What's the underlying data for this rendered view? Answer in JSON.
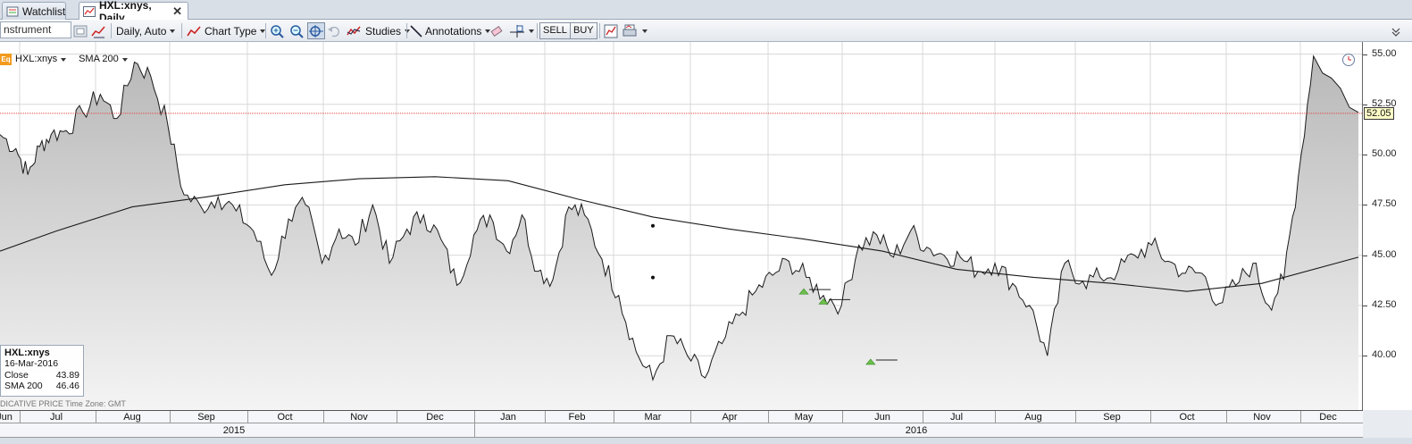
{
  "tabs": [
    {
      "label": "Watchlist",
      "icon": "watchlist-icon",
      "active": false
    },
    {
      "label": "HXL:xnys, Daily",
      "icon": "chart-tab-icon",
      "active": true,
      "close": "✕"
    }
  ],
  "toolbar": {
    "instrument_value": "nstrument",
    "interval_label": "Daily,  Auto",
    "chart_type_label": "Chart Type",
    "studies_label": "Studies",
    "annotations_label": "Annotations",
    "sell_label": "SELL",
    "buy_label": "BUY"
  },
  "legend": {
    "badge": "Eq",
    "symbol": "HXL:xnys",
    "study": "SMA 200"
  },
  "info_box": {
    "title": "HXL:xnys",
    "date": "16-Mar-2016",
    "close_label": "Close",
    "close_value": "43.89",
    "sma_label": "SMA 200",
    "sma_value": "46.46"
  },
  "footer_note": "DICATIVE PRICE    Time Zone: GMT",
  "price_tag": "52.05",
  "colors": {
    "area_fill": "#cfcfcf",
    "price_line": "#1a1a1a",
    "sma_line": "#1a1a1a",
    "last_price_line": "#d44",
    "marker": "#6cc04a"
  },
  "chart_data": {
    "type": "area",
    "ylim": [
      37.3,
      55.6
    ],
    "y_ticks": [
      "55.00",
      "52.50",
      "50.00",
      "47.50",
      "45.00",
      "42.50",
      "40.00"
    ],
    "y_tick_values": [
      55,
      52.5,
      50,
      47.5,
      45,
      42.5,
      40
    ],
    "x_month_labels": [
      "Jun",
      "Jul",
      "Aug",
      "Sep",
      "Oct",
      "Nov",
      "Dec",
      "Jan",
      "Feb",
      "Mar",
      "Apr",
      "May",
      "Jun",
      "Jul",
      "Aug",
      "Sep",
      "Oct",
      "Nov",
      "Dec"
    ],
    "years": [
      "2015",
      "2016"
    ],
    "last_price": 52.05,
    "series": [
      {
        "name": "HXL:xnys",
        "x": [
          0,
          0.22,
          0.45,
          0.68,
          0.9,
          1.13,
          1.35,
          1.58,
          1.8,
          2.03,
          2.25,
          2.48,
          2.7,
          2.93,
          3.15,
          3.38,
          3.6,
          3.83,
          4.05,
          4.28,
          4.5,
          4.73,
          4.95,
          5.18,
          5.4,
          5.63,
          5.85,
          6.08,
          6.3,
          6.53,
          6.75,
          6.98,
          7.2,
          7.43,
          7.65,
          7.88,
          8.1,
          8.33,
          8.55,
          8.78,
          9.0,
          9.23,
          9.45,
          9.68,
          9.9,
          10.13,
          10.35,
          10.58,
          10.8,
          11.03,
          11.25,
          11.48,
          11.7,
          11.93,
          12.15,
          12.38,
          12.6,
          12.83,
          13.05,
          13.28,
          13.5,
          13.73,
          13.95,
          14.18,
          14.4,
          14.63,
          14.85,
          15.08,
          15.3,
          15.53,
          15.75,
          15.98,
          16.2,
          16.43,
          16.65,
          16.88,
          17.1,
          17.33,
          17.55,
          17.78,
          18.0
        ],
        "values": [
          51.0,
          50.3,
          49.0,
          50.4,
          51.0,
          51.2,
          52.1,
          53.0,
          51.8,
          54.6,
          53.9,
          51.5,
          48.0,
          47.4,
          47.9,
          47.2,
          46.2,
          44.0,
          46.8,
          47.5,
          44.6,
          46.3,
          45.5,
          47.5,
          44.6,
          46.3,
          47.0,
          45.8,
          43.5,
          46.0,
          47.0,
          45.2,
          47.0,
          44.2,
          43.8,
          47.4,
          47.0,
          44.8,
          43.0,
          40.2,
          38.8,
          41.0,
          40.0,
          38.9,
          40.6,
          42.0,
          43.2,
          44.0,
          44.7,
          43.9,
          43.0,
          42.5,
          45.5,
          46.0,
          44.9,
          46.2,
          45.4,
          45.0,
          44.9,
          44.2,
          44.6,
          43.6,
          42.5,
          40.0,
          44.6,
          43.7,
          43.9,
          44.2,
          45.0,
          45.5,
          44.7,
          44.1,
          44.1,
          42.6,
          43.5,
          44.6,
          42.5,
          43.8,
          48.9,
          54.9,
          52.1
        ],
        "comment_high": 55.0,
        "comment_low": 38.3
      },
      {
        "name": "SMA 200",
        "x": [
          0,
          1,
          2,
          3,
          4,
          5,
          6,
          7,
          8,
          9,
          10,
          11,
          12,
          13,
          14,
          15,
          16,
          17,
          18
        ],
        "values": [
          45.2,
          46.2,
          47.4,
          47.9,
          48.5,
          48.8,
          48.9,
          48.7,
          47.8,
          46.9,
          46.3,
          45.8,
          45.2,
          44.3,
          43.9,
          43.6,
          43.2,
          43.6,
          44.9
        ]
      }
    ],
    "markers": [
      {
        "label": "",
        "x": 11.0,
        "y": 43.2
      },
      {
        "label": "",
        "x": 11.25,
        "y": 42.7
      },
      {
        "label": "",
        "x": 11.85,
        "y": 39.7
      }
    ]
  }
}
